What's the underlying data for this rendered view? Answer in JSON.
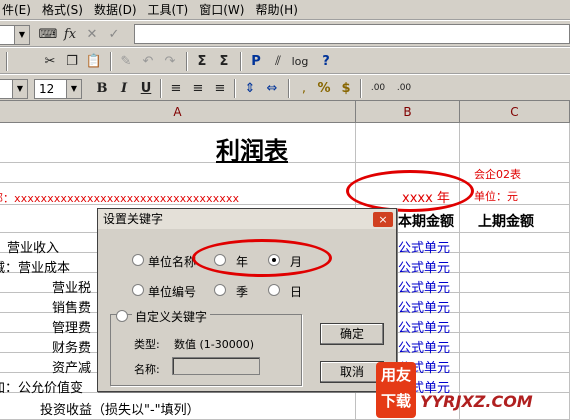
{
  "menu": [
    "件(E)",
    "格式(S)",
    "数据(D)",
    "工具(T)",
    "窗口(W)",
    "帮助(H)"
  ],
  "toolbar": {
    "fx": "fx",
    "font_size": "12",
    "bold": "B",
    "italic": "I",
    "underline": "U",
    "percent": "%",
    "currency": "$",
    "inc_decimal": ".00",
    "dec_decimal": ".00",
    "sum": "Σ",
    "sort": "Σ",
    "pbutton": "P",
    "log": "log",
    "help": "?"
  },
  "columns": {
    "a": "A",
    "b": "B",
    "c": "C"
  },
  "sheet": {
    "title": "利润表",
    "form_code": "会企02表",
    "unit_label": "单位：元",
    "unit_row": "部：xxxxxxxxxxxxxxxxxxxxxxxxxxxxxxxxxx",
    "year_cell": "xxxx 年",
    "current_header": "本期金额",
    "prior_header": "上期金额",
    "rows": [
      "、营业收入",
      "减：营业成本",
      "营业税",
      "销售费",
      "管理费",
      "财务费",
      "资产减",
      "加：公允价值变",
      "投资收益（损失以\"-\"填列）"
    ],
    "formula_cell": "公式单元"
  },
  "dialog": {
    "title": "设置关键字",
    "close": "×",
    "opt_unit_name": "单位名称",
    "opt_year": "年",
    "opt_month": "月",
    "opt_unit_code": "单位编号",
    "opt_quarter": "季",
    "opt_day": "日",
    "opt_custom": "自定义关键字",
    "type_label": "类型:",
    "type_value": "数值 (1-30000)",
    "name_label": "名称:",
    "name_value": "",
    "ok": "确定",
    "cancel": "取消"
  },
  "watermark": {
    "brand1": "用友",
    "brand2": "下载",
    "site": "YYRJXZ.COM"
  }
}
